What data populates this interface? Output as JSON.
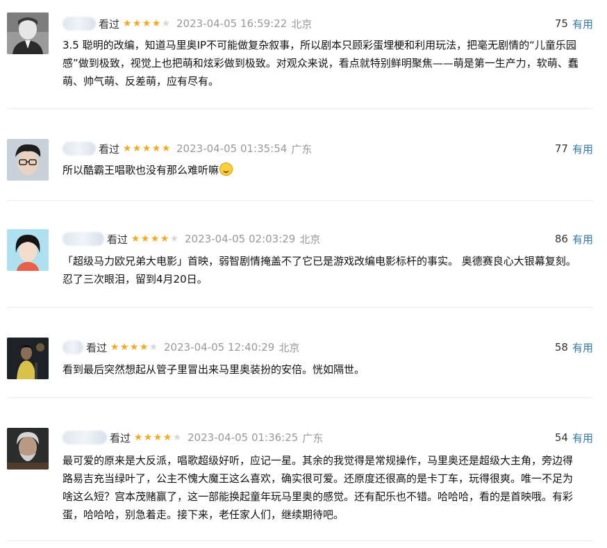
{
  "reviews": [
    {
      "status": "看过",
      "rating": 4,
      "time": "2023-04-05 16:59:22",
      "location": "北京",
      "votes": "75",
      "useful_label": "有用",
      "content": "3.5 聪明的改编，知道马里奥IP不可能做复杂叙事，所以剧本只顾彩蛋埋梗和利用玩法，把毫无剧情的“儿童乐园感”做到极致，视觉上也把萌和炫彩做到极致。对观众来说，看点就特别鲜明聚焦——萌是第一生产力，软萌、蠢萌、帅气萌、反差萌，应有尽有。"
    },
    {
      "status": "看过",
      "rating": 5,
      "time": "2023-04-05 01:35:54",
      "location": "广东",
      "votes": "77",
      "useful_label": "有用",
      "content": "所以酷霸王唱歌也没有那么难听嘛"
    },
    {
      "status": "看过",
      "rating": 4,
      "time": "2023-04-05 02:03:29",
      "location": "北京",
      "votes": "86",
      "useful_label": "有用",
      "content": "「超级马力欧兄弟大电影」首映，弱智剧情掩盖不了它已是游戏改编电影标杆的事实。 奥德赛良心大银幕复刻。忍了三次眼泪，留到4月20日。"
    },
    {
      "status": "看过",
      "rating": 4,
      "time": "2023-04-05 12:40:29",
      "location": "北京",
      "votes": "58",
      "useful_label": "有用",
      "content": "看到最后突然想起从管子里冒出来马里奥装扮的安倍。恍如隔世。"
    },
    {
      "status": "看过",
      "rating": 4,
      "time": "2023-04-05 01:36:25",
      "location": "广东",
      "votes": "54",
      "useful_label": "有用",
      "content": "最可爱的原来是大反派，唱歌超级好听，应记一星。其余的我觉得是常规操作，马里奥还是超级大主角，旁边得路易吉充当绿叶了，公主不愧大魔王这么喜欢，确实很可爱。还原度还很高的是卡丁车，玩得很爽。唯一不足为啥这么短？宫本茂赌赢了，这一部能换起童年玩马里奥的感觉。还有配乐也不错。哈哈哈，看的是首映哦。有彩蛋，哈哈哈，别急着走。接下来，老任家人们，继续期待吧。"
    }
  ],
  "colors": {
    "star": "#f4a91f",
    "star_off": "#d8d8d8",
    "useful": "#3377aa",
    "meta": "#999999"
  },
  "icons": {
    "emoji_in_review_2": "grinning-face-icon"
  }
}
